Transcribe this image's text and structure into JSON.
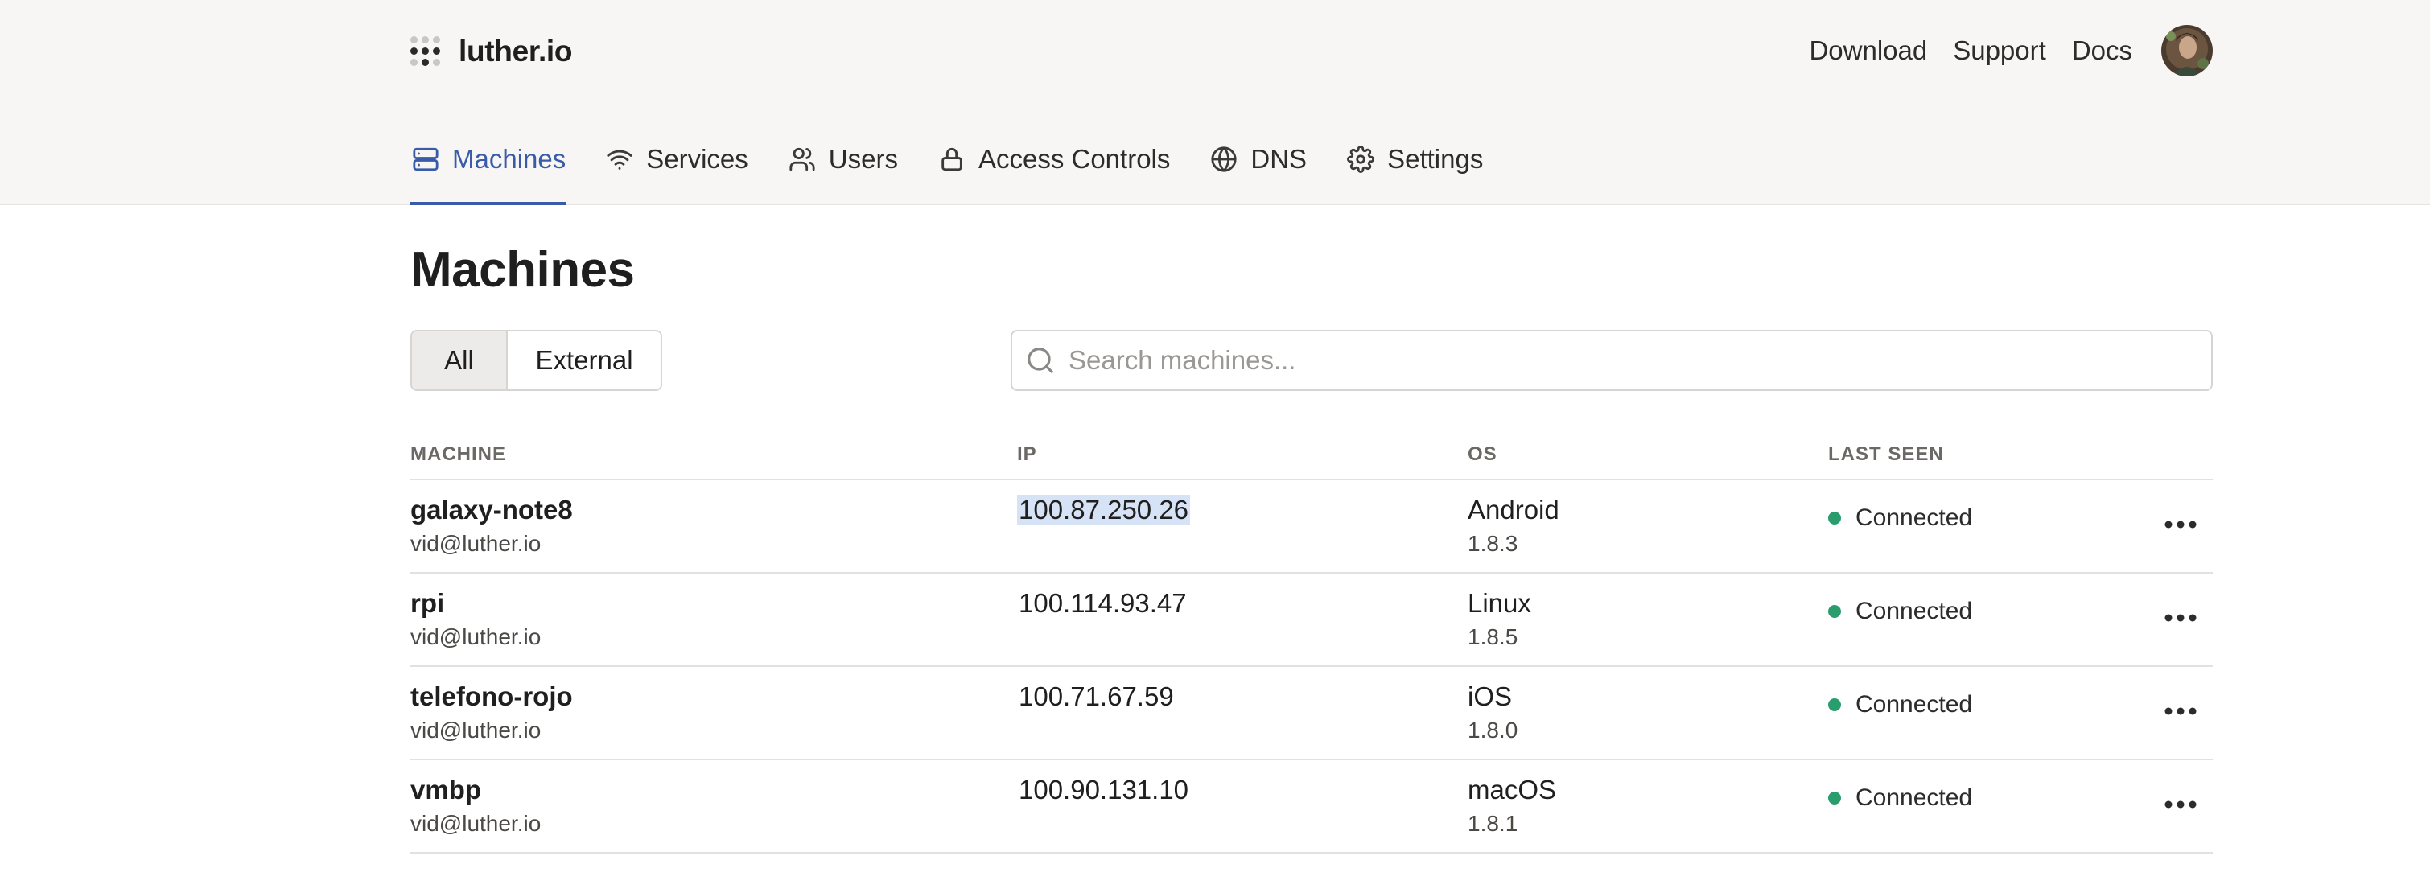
{
  "brand": {
    "name": "luther.io",
    "icon": "dots-grid-icon"
  },
  "top_links": [
    {
      "label": "Download"
    },
    {
      "label": "Support"
    },
    {
      "label": "Docs"
    }
  ],
  "nav": [
    {
      "label": "Machines",
      "icon": "server-icon",
      "active": true
    },
    {
      "label": "Services",
      "icon": "wifi-icon",
      "active": false
    },
    {
      "label": "Users",
      "icon": "users-icon",
      "active": false
    },
    {
      "label": "Access Controls",
      "icon": "lock-icon",
      "active": false
    },
    {
      "label": "DNS",
      "icon": "globe-icon",
      "active": false
    },
    {
      "label": "Settings",
      "icon": "gear-icon",
      "active": false
    }
  ],
  "page": {
    "title": "Machines"
  },
  "filters": {
    "all": "All",
    "external": "External",
    "selected": "All"
  },
  "search": {
    "placeholder": "Search machines...",
    "value": ""
  },
  "table": {
    "columns": {
      "machine": "MACHINE",
      "ip": "IP",
      "os": "OS",
      "last_seen": "LAST SEEN"
    },
    "rows": [
      {
        "name": "galaxy-note8",
        "owner": "vid@luther.io",
        "ip": "100.87.250.26",
        "os": "Android",
        "version": "1.8.3",
        "status": "Connected"
      },
      {
        "name": "rpi",
        "owner": "vid@luther.io",
        "ip": "100.114.93.47",
        "os": "Linux",
        "version": "1.8.5",
        "status": "Connected"
      },
      {
        "name": "telefono-rojo",
        "owner": "vid@luther.io",
        "ip": "100.71.67.59",
        "os": "iOS",
        "version": "1.8.0",
        "status": "Connected"
      },
      {
        "name": "vmbp",
        "owner": "vid@luther.io",
        "ip": "100.90.131.10",
        "os": "macOS",
        "version": "1.8.1",
        "status": "Connected"
      }
    ]
  },
  "colors": {
    "accent": "#3a5ba8",
    "connected": "#2a9d6e",
    "header_bg": "#f7f6f4"
  }
}
